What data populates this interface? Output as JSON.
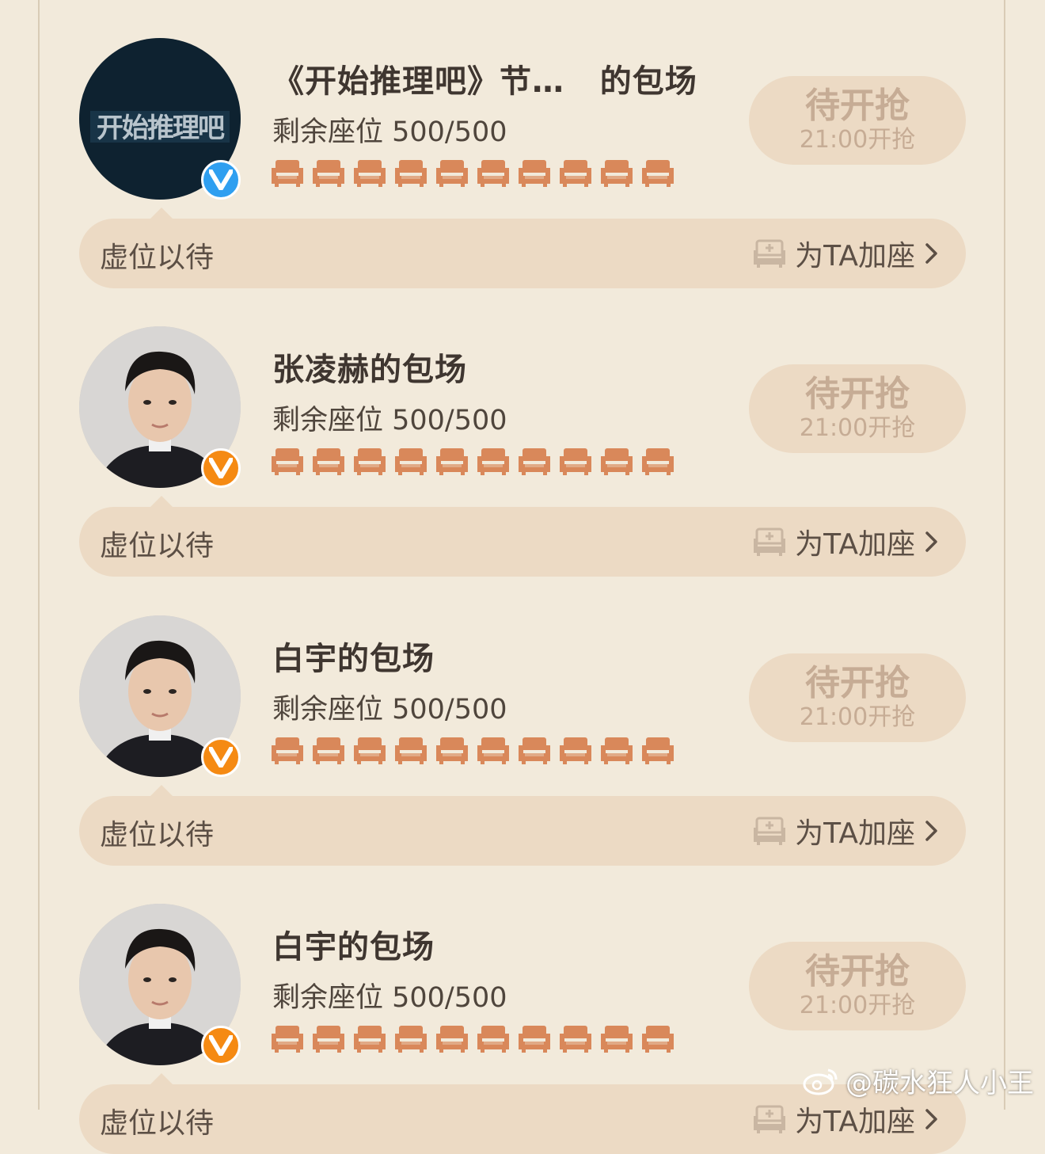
{
  "list": [
    {
      "title": "《开始推理吧》节…   的包场",
      "avatar": {
        "kind": "logo",
        "logo_text": "开始推理吧",
        "badge": "blue"
      },
      "seats_text": "剩余座位 500/500",
      "seat_count": 10,
      "button": {
        "main": "待开抢",
        "sub": "21:00开抢"
      },
      "bar": {
        "label": "虚位以待",
        "action": "为TA加座"
      }
    },
    {
      "title": "张凌赫的包场",
      "avatar": {
        "kind": "person",
        "badge": "orange"
      },
      "seats_text": "剩余座位 500/500",
      "seat_count": 10,
      "button": {
        "main": "待开抢",
        "sub": "21:00开抢"
      },
      "bar": {
        "label": "虚位以待",
        "action": "为TA加座"
      }
    },
    {
      "title": "白宇的包场",
      "avatar": {
        "kind": "person",
        "badge": "orange"
      },
      "seats_text": "剩余座位 500/500",
      "seat_count": 10,
      "button": {
        "main": "待开抢",
        "sub": "21:00开抢"
      },
      "bar": {
        "label": "虚位以待",
        "action": "为TA加座"
      }
    },
    {
      "title": "白宇的包场",
      "avatar": {
        "kind": "person",
        "badge": "orange"
      },
      "seats_text": "剩余座位 500/500",
      "seat_count": 10,
      "button": {
        "main": "待开抢",
        "sub": "21:00开抢"
      },
      "bar": {
        "label": "虚位以待",
        "action": "为TA加座"
      }
    }
  ],
  "watermark": "@碳水狂人小王",
  "colors": {
    "background": "#f2eadb",
    "pill": "#ecdac4",
    "seat": "#d9885a",
    "badge_blue": "#2f9ff0",
    "badge_orange": "#f58a13",
    "button_text": "#c6ac95"
  }
}
